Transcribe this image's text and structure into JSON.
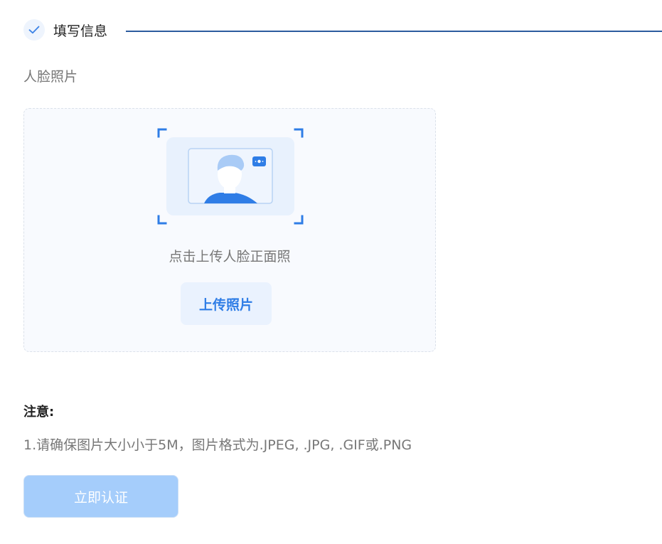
{
  "step": {
    "title": "填写信息",
    "icon": "check-icon",
    "accent": "#2c5c9e"
  },
  "section": {
    "label": "人脸照片"
  },
  "upload": {
    "illustration_icon": "face-photo-icon",
    "hint": "点击上传人脸正面照",
    "button_label": "上传照片",
    "accent": "#2f7de6"
  },
  "notes": {
    "title": "注意:",
    "items": [
      "1.请确保图片大小小于5M，图片格式为.JPEG, .JPG, .GIF或.PNG"
    ]
  },
  "submit": {
    "label": "立即认证",
    "state": "disabled",
    "color": "#a5cdfb"
  }
}
